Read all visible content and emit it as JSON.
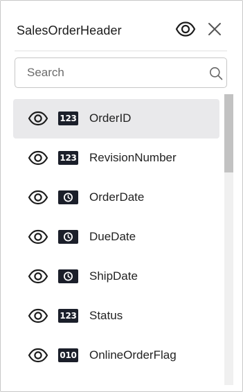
{
  "panel": {
    "title": "SalesOrderHeader"
  },
  "search": {
    "placeholder": "Search",
    "value": ""
  },
  "colors": {
    "badge_bg": "#1b1f2a",
    "selected_row_bg": "#e9e9eb",
    "scroll_thumb": "#c2c2c2"
  },
  "fields": [
    {
      "label": "OrderID",
      "type_badge": "123",
      "type": "number",
      "selected": true,
      "visible_icon": "eye-icon"
    },
    {
      "label": "RevisionNumber",
      "type_badge": "123",
      "type": "number",
      "selected": false,
      "visible_icon": "eye-icon"
    },
    {
      "label": "OrderDate",
      "type_badge": "clock",
      "type": "datetime",
      "selected": false,
      "visible_icon": "eye-icon"
    },
    {
      "label": "DueDate",
      "type_badge": "clock",
      "type": "datetime",
      "selected": false,
      "visible_icon": "eye-icon"
    },
    {
      "label": "ShipDate",
      "type_badge": "clock",
      "type": "datetime",
      "selected": false,
      "visible_icon": "eye-icon"
    },
    {
      "label": "Status",
      "type_badge": "123",
      "type": "number",
      "selected": false,
      "visible_icon": "eye-icon"
    },
    {
      "label": "OnlineOrderFlag",
      "type_badge": "010",
      "type": "boolean",
      "selected": false,
      "visible_icon": "eye-icon"
    }
  ]
}
